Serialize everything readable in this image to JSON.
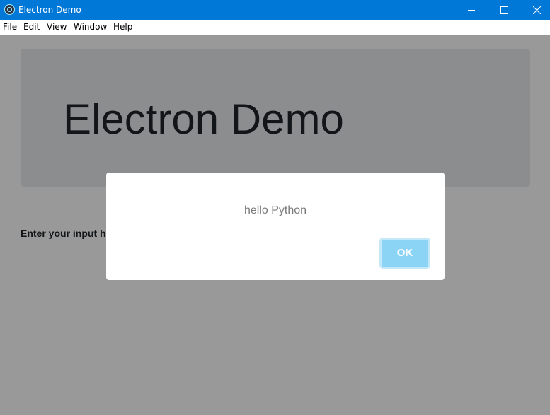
{
  "window": {
    "title": "Electron Demo",
    "accent_color": "#0078d7",
    "icons": {
      "app": "electron-icon",
      "minimize": "minimize-icon",
      "maximize": "maximize-icon",
      "close": "close-icon"
    }
  },
  "menubar": {
    "items": [
      {
        "label": "File"
      },
      {
        "label": "Edit"
      },
      {
        "label": "View"
      },
      {
        "label": "Window"
      },
      {
        "label": "Help"
      }
    ]
  },
  "main": {
    "heading": "Electron Demo",
    "input_label": "Enter your input here"
  },
  "dialog": {
    "message": "hello Python",
    "ok_label": "OK",
    "ok_color": "#8cd4f5"
  }
}
